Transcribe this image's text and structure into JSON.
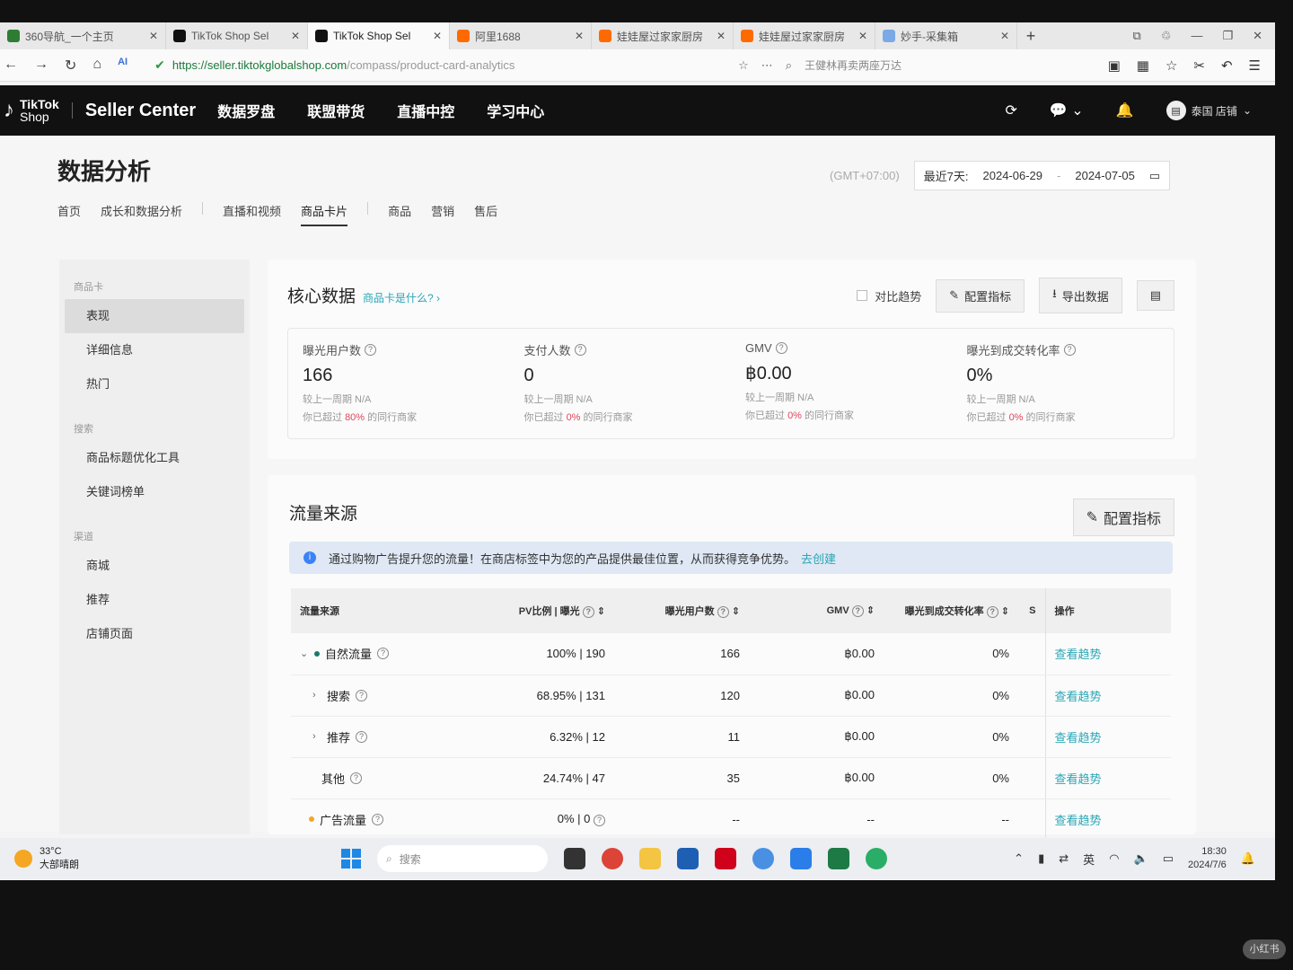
{
  "browser": {
    "tabs": [
      {
        "title": "360导航_一个主页",
        "color": "#2e7d32"
      },
      {
        "title": "TikTok Shop Sel",
        "color": "#111111"
      },
      {
        "title": "TikTok Shop Sel",
        "color": "#111111"
      },
      {
        "title": "阿里1688",
        "color": "#ff6a00"
      },
      {
        "title": "娃娃屋过家家厨房",
        "color": "#ff6a00"
      },
      {
        "title": "娃娃屋过家家厨房",
        "color": "#ff6a00"
      },
      {
        "title": "妙手-采集箱",
        "color": "#7aa9e6"
      }
    ],
    "url_host": "https://seller.tiktokglobalshop.com",
    "url_path": "/compass/product-card-analytics",
    "search_hint": "王健林再卖两座万达"
  },
  "header": {
    "logo_line1": "TikTok",
    "logo_line2": "Shop",
    "seller_center": "Seller Center",
    "nav": [
      "数据罗盘",
      "联盟带货",
      "直播中控",
      "学习中心"
    ],
    "shop": "泰国 店铺"
  },
  "page": {
    "title": "数据分析",
    "timezone": "(GMT+07:00)",
    "range_label": "最近7天:",
    "date_start": "2024-06-29",
    "date_sep": "-",
    "date_end": "2024-07-05",
    "subnav": [
      "首页",
      "成长和数据分析",
      "直播和视频",
      "商品卡片",
      "商品",
      "营销",
      "售后"
    ]
  },
  "sidebar": {
    "group1": "商品卡",
    "items1": [
      "表现",
      "详细信息",
      "热门"
    ],
    "group2": "搜索",
    "items2": [
      "商品标题优化工具",
      "关键词榜单"
    ],
    "group3": "渠道",
    "items3": [
      "商城",
      "推荐",
      "店铺页面"
    ]
  },
  "core": {
    "title": "核心数据",
    "link": "商品卡是什么?",
    "compare": "对比趋势",
    "config": "配置指标",
    "export": "导出数据",
    "metrics": [
      {
        "label": "曝光用户数",
        "value": "166",
        "compare": "较上一周期 N/A",
        "beat_pre": "你已超过",
        "beat_pct": "80%",
        "beat_post": "的同行商家"
      },
      {
        "label": "支付人数",
        "value": "0",
        "compare": "较上一周期 N/A",
        "beat_pre": "你已超过",
        "beat_pct": "0%",
        "beat_post": "的同行商家"
      },
      {
        "label": "GMV",
        "value": "฿0.00",
        "compare": "较上一周期 N/A",
        "beat_pre": "你已超过",
        "beat_pct": "0%",
        "beat_post": "的同行商家"
      },
      {
        "label": "曝光到成交转化率",
        "value": "0%",
        "compare": "较上一周期 N/A",
        "beat_pre": "你已超过",
        "beat_pct": "0%",
        "beat_post": "的同行商家"
      }
    ]
  },
  "traffic": {
    "title": "流量来源",
    "config": "配置指标",
    "notice": "通过购物广告提升您的流量！在商店标签中为您的产品提供最佳位置，从而获得竞争优势。",
    "notice_link": "去创建",
    "columns": [
      "流量来源",
      "PV比例 | 曝光",
      "曝光用户数",
      "GMV",
      "曝光到成交转化率",
      "S",
      "操作"
    ],
    "rows": [
      {
        "caret": "⌄",
        "dot": "#1a7a6a",
        "name": "自然流量",
        "pv": "100% | 190",
        "users": "166",
        "gmv": "฿0.00",
        "cvr": "0%",
        "action": "查看趋势"
      },
      {
        "caret": "›",
        "dot": "",
        "name": "搜索",
        "pv": "68.95% | 131",
        "users": "120",
        "gmv": "฿0.00",
        "cvr": "0%",
        "action": "查看趋势"
      },
      {
        "caret": "›",
        "dot": "",
        "name": "推荐",
        "pv": "6.32% | 12",
        "users": "11",
        "gmv": "฿0.00",
        "cvr": "0%",
        "action": "查看趋势"
      },
      {
        "caret": "",
        "dot": "",
        "name": "其他",
        "pv": "24.74% | 47",
        "users": "35",
        "gmv": "฿0.00",
        "cvr": "0%",
        "action": "查看趋势"
      },
      {
        "caret": "",
        "dot": "#f5a623",
        "name": "广告流量",
        "pv": "0% | 0",
        "users": "--",
        "gmv": "--",
        "cvr": "--",
        "action": "查看趋势"
      }
    ]
  },
  "taskbar": {
    "temp": "33°C",
    "weather": "大部晴朗",
    "search": "搜索",
    "ime": "英",
    "time": "18:30",
    "date": "2024/7/6"
  },
  "watermark": "小红书"
}
